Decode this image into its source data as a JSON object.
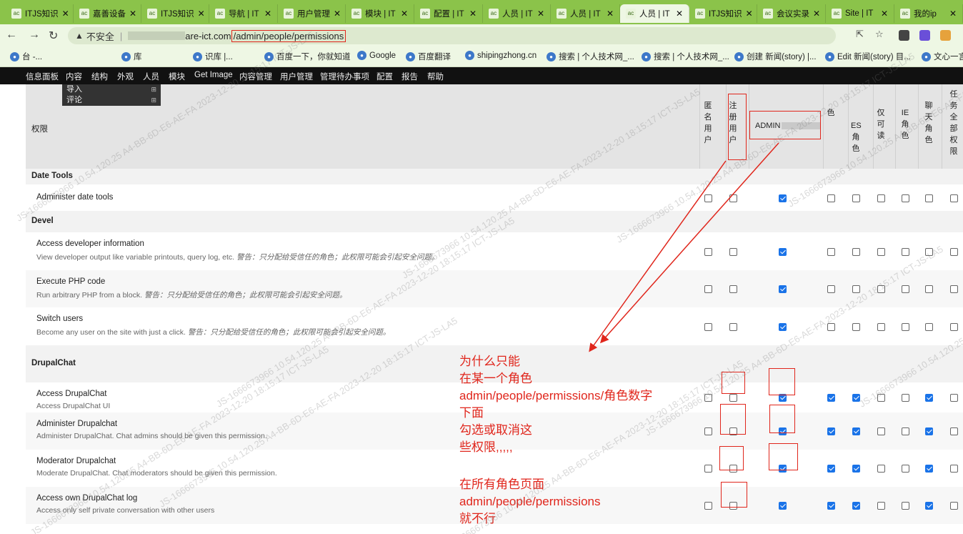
{
  "tabs": [
    {
      "label": "ITJS知识"
    },
    {
      "label": "嘉善设备"
    },
    {
      "label": "ITJS知识"
    },
    {
      "label": "导航 | IT"
    },
    {
      "label": "用户管理"
    },
    {
      "label": "模块 | IT"
    },
    {
      "label": "配置 | IT"
    },
    {
      "label": "人员 | IT"
    },
    {
      "label": "人员 | IT"
    },
    {
      "label": "人员 | IT"
    },
    {
      "label": "ITJS知识"
    },
    {
      "label": "会议实录"
    },
    {
      "label": "Site | IT"
    },
    {
      "label": "我的ip"
    }
  ],
  "address": {
    "warning": "不安全",
    "domain": "are-ict.com",
    "path": "/admin/people/permissions"
  },
  "bookmarks": [
    "台 -...",
    "库",
    "识库 |...",
    "百度一下，你就知道",
    "Google",
    "百度翻译",
    "shipingzhong.cn",
    "搜索 | 个人技术网_...",
    "搜索 | 个人技术网_...",
    "创建 新闻(story) |...",
    "Edit 新闻(story) 目...",
    "文心一言"
  ],
  "admin_menu": [
    "信息面板",
    "内容",
    "结构",
    "外观",
    "人员",
    "模块",
    "Get Image",
    "内容管理",
    "用户管理",
    "管理待办事项",
    "配置",
    "报告",
    "帮助"
  ],
  "dropdown": [
    "导入",
    "评论"
  ],
  "table": {
    "perm_header": "权限",
    "roles": [
      {
        "name": "匿名用户"
      },
      {
        "name": "注册用户"
      },
      {
        "name": "ADMIN"
      },
      {
        "name": "色"
      },
      {
        "name": "ES角色"
      },
      {
        "name": "仅可读"
      },
      {
        "name": "IE角色"
      },
      {
        "name": "聊天角色"
      },
      {
        "name": "任务全部权限"
      }
    ],
    "rows": [
      {
        "type": "cat",
        "title": "Date Tools"
      },
      {
        "type": "perm",
        "title": "Administer date tools",
        "desc": "",
        "warn": "",
        "checks": [
          false,
          false,
          true,
          false,
          false,
          false,
          false,
          false,
          false
        ]
      },
      {
        "type": "cat",
        "title": "Devel"
      },
      {
        "type": "perm",
        "title": "Access developer information",
        "desc": "View developer output like variable printouts, query log, etc.",
        "warn": "警告：只分配给受信任的角色；此权限可能会引起安全问题。",
        "checks": [
          false,
          false,
          true,
          false,
          false,
          false,
          false,
          false,
          false
        ]
      },
      {
        "type": "perm",
        "title": "Execute PHP code",
        "desc": "Run arbitrary PHP from a block.",
        "warn": "警告：只分配给受信任的角色；此权限可能会引起安全问题。",
        "checks": [
          false,
          false,
          true,
          false,
          false,
          false,
          false,
          false,
          false
        ]
      },
      {
        "type": "perm",
        "title": "Switch users",
        "desc": "Become any user on the site with just a click.",
        "warn": "警告：只分配给受信任的角色；此权限可能会引起安全问题。",
        "checks": [
          false,
          false,
          true,
          false,
          false,
          false,
          false,
          false,
          false
        ]
      },
      {
        "type": "cat",
        "title": "DrupalChat"
      },
      {
        "type": "perm",
        "title": "Access DrupalChat",
        "desc": "Access DrupalChat UI",
        "warn": "",
        "checks": [
          false,
          false,
          true,
          true,
          true,
          false,
          false,
          true,
          false
        ]
      },
      {
        "type": "perm",
        "title": "Administer Drupalchat",
        "desc": "Administer DrupalChat. Chat admins should be given this permission.",
        "warn": "",
        "checks": [
          false,
          false,
          true,
          true,
          true,
          false,
          false,
          true,
          false
        ]
      },
      {
        "type": "perm",
        "title": "Moderator Drupalchat",
        "desc": "Moderate DrupalChat. Chat moderators should be given this permission.",
        "warn": "",
        "checks": [
          false,
          false,
          true,
          true,
          true,
          false,
          false,
          true,
          false
        ]
      },
      {
        "type": "perm",
        "title": "Access own DrupalChat log",
        "desc": "Access only self private conversation with other users",
        "warn": "",
        "checks": [
          false,
          false,
          true,
          true,
          true,
          false,
          false,
          true,
          false
        ]
      }
    ]
  },
  "annotation": {
    "lines_a": [
      "为什么只能",
      "在某一个角色",
      "admin/people/permissions/角色数字",
      "下面",
      "勾选或取消这",
      "些权限,,,,,"
    ],
    "lines_b": [
      "在所有角色页面",
      "admin/people/permissions",
      "就不行"
    ]
  },
  "watermark": "JS-1666673966 10.54.120.25 A4-BB-6D-E6-AE-FA 2023-12-20 18:15:17 ICT-JS-LA5",
  "colors": {
    "tabbar": "#8bc34a",
    "accent": "#1a73e8",
    "annotation": "#e0261c"
  }
}
